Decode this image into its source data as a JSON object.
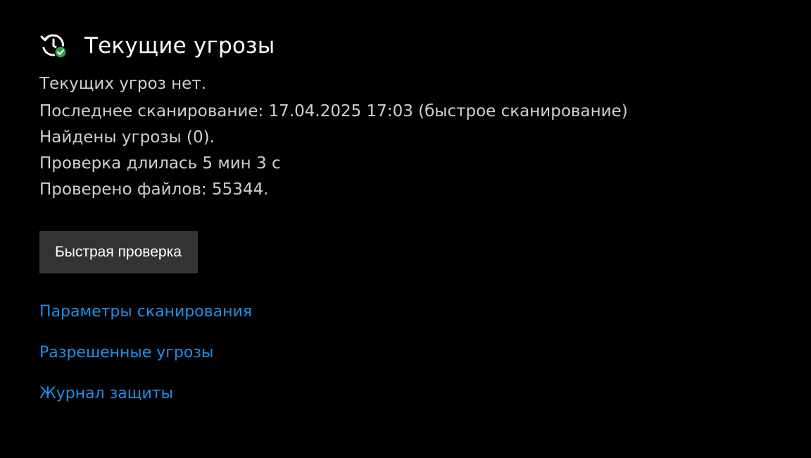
{
  "header": {
    "title": "Текущие угрозы",
    "icon": "history-shield-check-icon"
  },
  "status": {
    "text": "Текущих угроз нет."
  },
  "details": {
    "last_scan": "Последнее сканирование: 17.04.2025 17:03 (быстрое сканирование)",
    "threats_found": "Найдены угрозы (0).",
    "duration": "Проверка длилась 5 мин 3 с",
    "files_scanned": "Проверено файлов: 55344."
  },
  "actions": {
    "quick_scan_label": "Быстрая проверка"
  },
  "links": {
    "scan_options": "Параметры сканирования",
    "allowed_threats": "Разрешенные угрозы",
    "protection_history": "Журнал защиты"
  },
  "colors": {
    "background": "#000000",
    "link": "#1e8fe6",
    "button_bg": "#333333",
    "check_green": "#2ea043"
  }
}
